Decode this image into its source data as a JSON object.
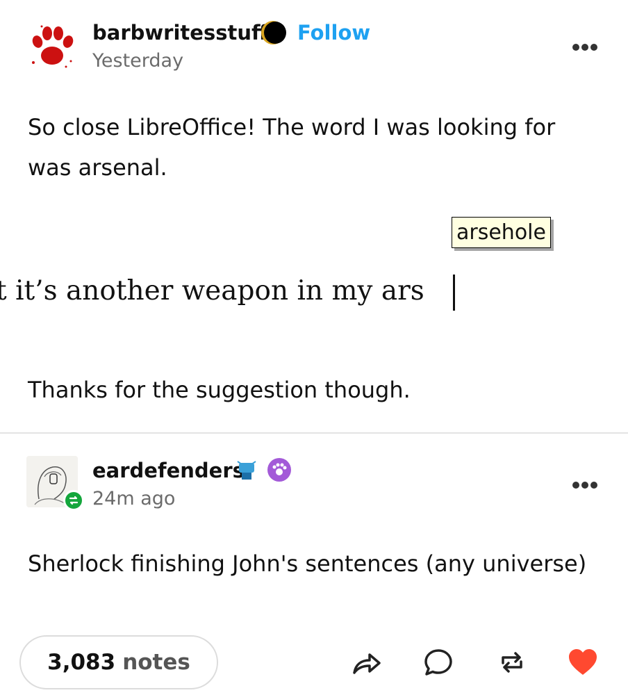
{
  "post1": {
    "username": "barbwritesstuff",
    "follow_label": "Follow",
    "timestamp": "Yesterday",
    "text1": "So close LibreOffice! The word I was looking for was arsenal.",
    "screenshot_line": "t it’s another weapon in my ars",
    "autocomplete_suggestion": "arsehole",
    "text2": "Thanks for the suggestion though."
  },
  "post2": {
    "username": "eardefenders",
    "timestamp": "24m ago",
    "text": "Sherlock finishing John's sentences (any universe)"
  },
  "footer": {
    "notes_count": "3,083",
    "notes_label": "notes",
    "actions": [
      "share-icon",
      "reply-icon",
      "reblog-icon",
      "like-icon"
    ]
  },
  "colors": {
    "follow": "#1ea1f1",
    "like": "#ff4930",
    "reblog_badge": "#14a63c",
    "paw": "#cc1111"
  }
}
